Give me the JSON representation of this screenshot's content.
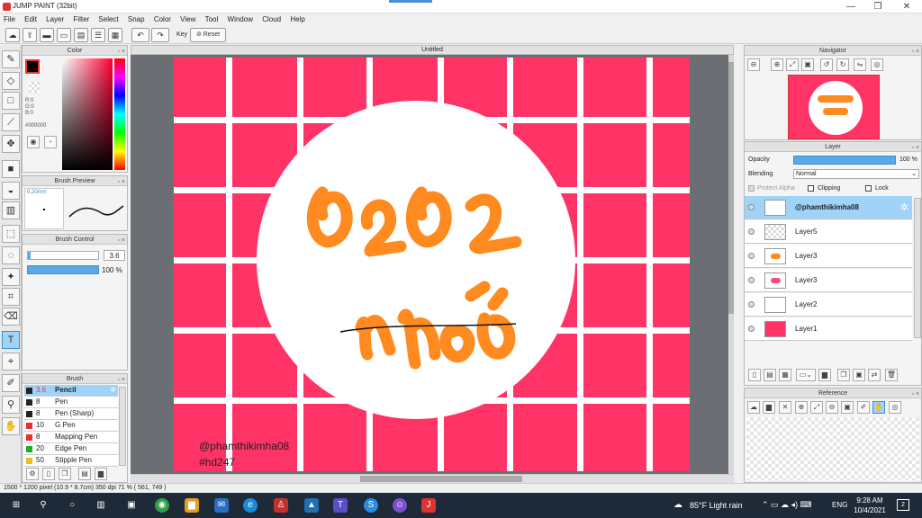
{
  "window": {
    "title": "JUMP PAINT (32bit)",
    "minimize": "—",
    "maximize": "❐",
    "close": "✕"
  },
  "menu": [
    "File",
    "Edit",
    "Layer",
    "Filter",
    "Select",
    "Snap",
    "Color",
    "View",
    "Tool",
    "Window",
    "Cloud",
    "Help"
  ],
  "toolbar": {
    "key_label": "Key",
    "reset_label": "Reset"
  },
  "color_panel": {
    "title": "Color",
    "r": "R:0",
    "g": "G:0",
    "b": "B:0",
    "hex": "#000000"
  },
  "brush_preview": {
    "title": "Brush Preview",
    "size": "0.20mm"
  },
  "brush_control": {
    "title": "Brush Control",
    "size_value": "3.6",
    "opacity_value": "100 %"
  },
  "brush_panel": {
    "title": "Brush",
    "items": [
      {
        "size": "3.6",
        "name": "Pencil",
        "color": "#222222"
      },
      {
        "size": "8",
        "name": "Pen",
        "color": "#222222"
      },
      {
        "size": "8",
        "name": "Pen (Sharp)",
        "color": "#222222"
      },
      {
        "size": "10",
        "name": "G Pen",
        "color": "#e83030"
      },
      {
        "size": "8",
        "name": "Mapping Pen",
        "color": "#e83030"
      },
      {
        "size": "20",
        "name": "Edge Pen",
        "color": "#22aa22"
      },
      {
        "size": "50",
        "name": "Stipple Pen",
        "color": "#e8c020"
      }
    ]
  },
  "canvas": {
    "tab_title": "Untitled",
    "watermark_handle": "@phamthikimha08",
    "watermark_tag": "#hd247"
  },
  "navigator": {
    "title": "Navigator"
  },
  "layer_panel": {
    "title": "Layer",
    "opacity_label": "Opacity",
    "opacity_value": "100 %",
    "blending_label": "Blending",
    "blending_value": "Normal",
    "protect_alpha": "Protect Alpha",
    "clipping": "Clipping",
    "lock": "Lock",
    "layers": [
      {
        "name": "@phamthikimha08",
        "selected": true
      },
      {
        "name": "Layer5",
        "selected": false
      },
      {
        "name": "Layer3",
        "selected": false
      },
      {
        "name": "Layer3",
        "selected": false
      },
      {
        "name": "Layer2",
        "selected": false
      },
      {
        "name": "Layer1",
        "selected": false
      }
    ]
  },
  "reference_panel": {
    "title": "Reference"
  },
  "status": {
    "text": "1500 * 1200 pixel   (10.9 * 8.7cm)   350 dpi   71 %   ( 561, 749 )"
  },
  "taskbar": {
    "weather": "85°F  Light rain",
    "lang": "ENG",
    "time": "9:28 AM",
    "date": "10/4/2021",
    "notif": "2"
  },
  "colors": {
    "art_bg": "#ff3366",
    "lettering": "#ff8a1f",
    "accent": "#3a8fd0"
  }
}
